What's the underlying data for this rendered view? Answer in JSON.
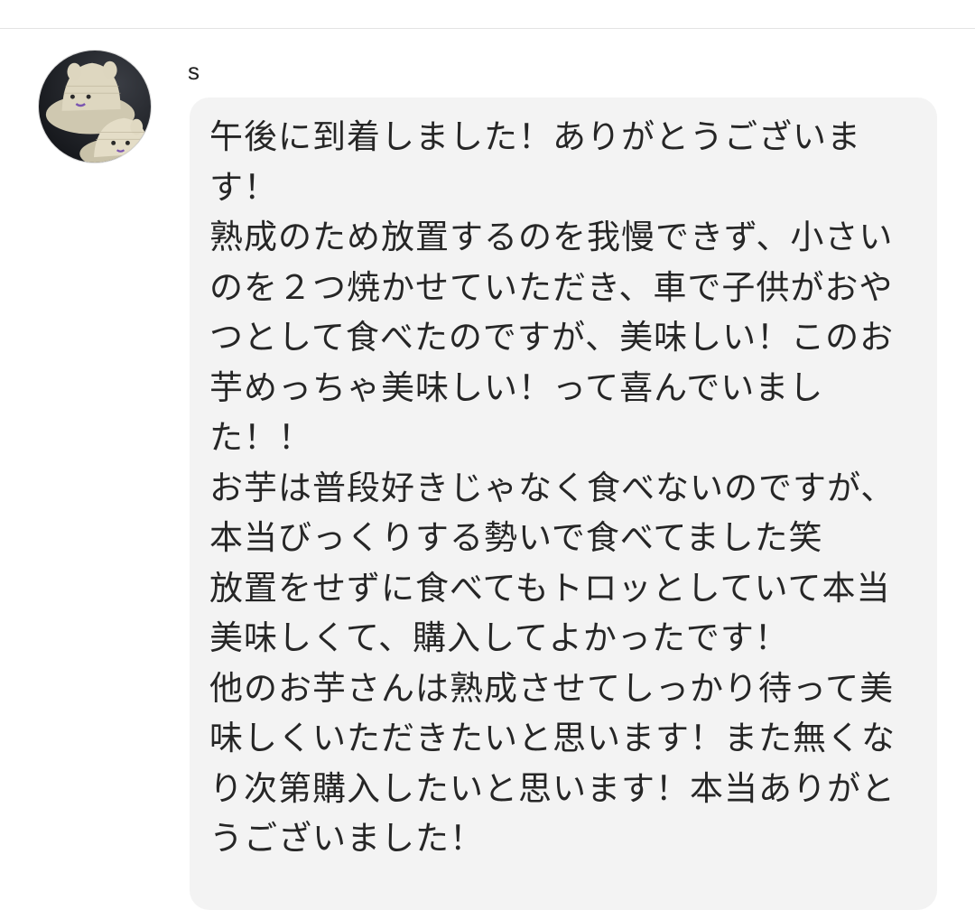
{
  "comment": {
    "username": "s",
    "avatar": "hat-photo-avatar",
    "message": "午後に到着しました！ありがとうございま\nす！\n熟成のため放置するのを我慢できず、小さい\nのを２つ焼かせていただき、車で子供がおや\nつとして食べたのですが、美味しい！このお\n芋めっちゃ美味しい！って喜んでいまし\nた！！\nお芋は普段好きじゃなく食べないのですが、\n本当びっくりする勢いで食べてました笑\n放置をせずに食べてもトロッとしていて本当\n美味しくて、購入してよかったです！\n他のお芋さんは熟成させてしっかり待って美\n味しくいただきたいと思います！また無くな\nり次第購入したいと思います！本当ありがと\nうございました！"
  },
  "colors": {
    "bubble_background": "#f3f3f3",
    "text": "#262626",
    "divider": "#e3e3e3"
  }
}
